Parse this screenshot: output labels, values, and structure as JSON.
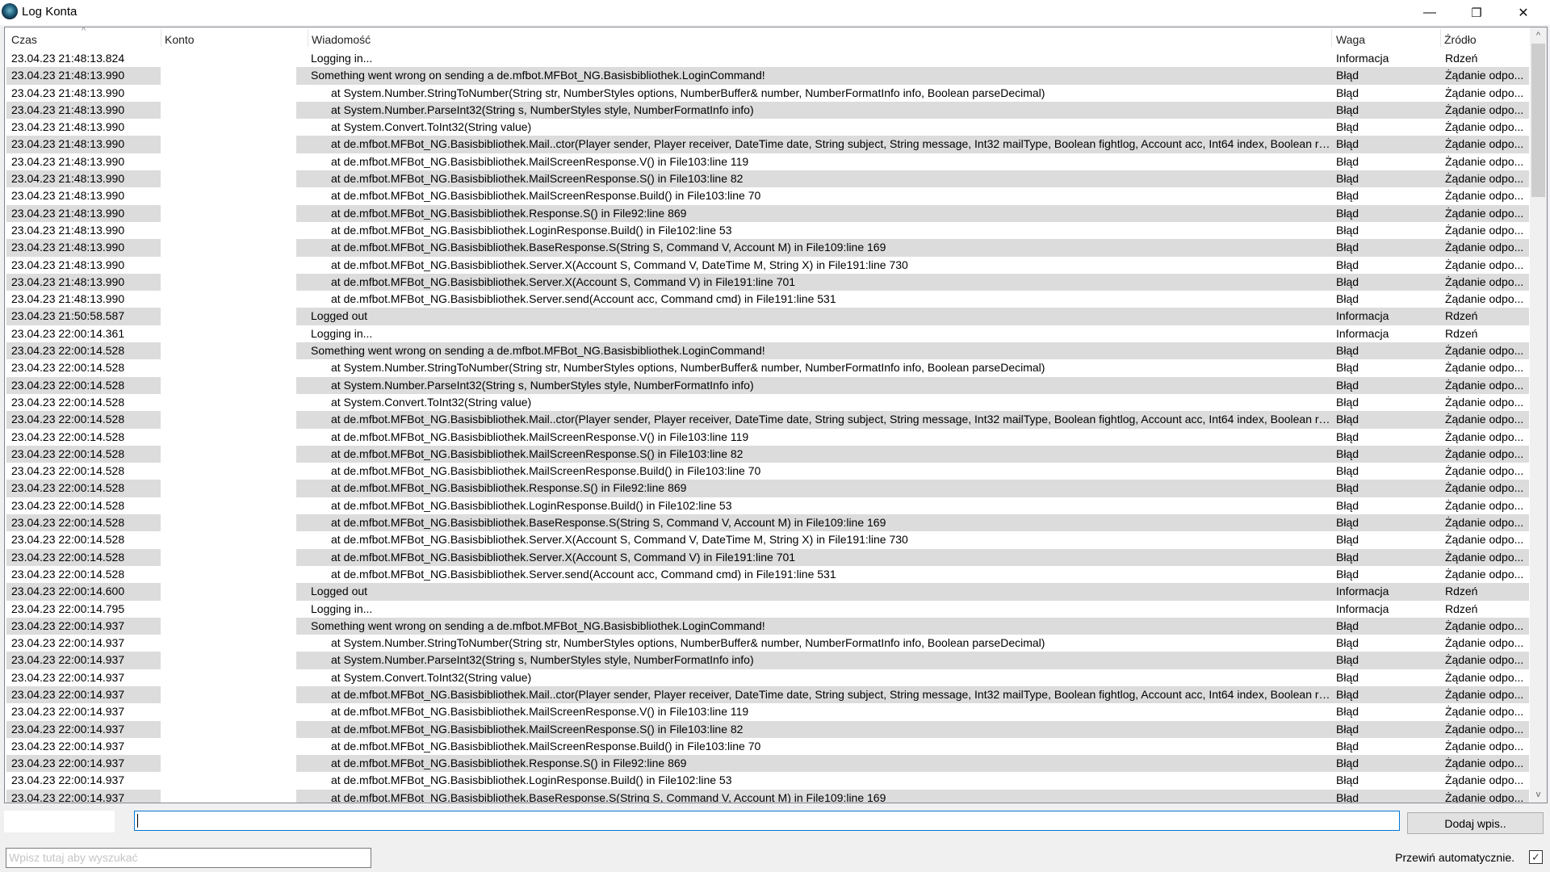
{
  "window": {
    "title": "Log Konta",
    "minimize": "—",
    "restore": "❐",
    "close": "✕"
  },
  "columns": {
    "time": "Czas",
    "account": "Konto",
    "message": "Wiadomość",
    "weight": "Waga",
    "source": "Źródło"
  },
  "rows": [
    [
      "23.04.23 21:48:13.824",
      "",
      "Logging in...",
      "Informacja",
      "Rdzeń"
    ],
    [
      "23.04.23 21:48:13.990",
      "",
      "Something went wrong on sending a de.mfbot.MFBot_NG.Basisbibliothek.LoginCommand!",
      "Błąd",
      "Żądanie odpo..."
    ],
    [
      "23.04.23 21:48:13.990",
      "",
      "at System.Number.StringToNumber(String str, NumberStyles options, NumberBuffer& number, NumberFormatInfo info, Boolean parseDecimal)",
      "Błąd",
      "Żądanie odpo..."
    ],
    [
      "23.04.23 21:48:13.990",
      "",
      "at System.Number.ParseInt32(String s, NumberStyles style, NumberFormatInfo info)",
      "Błąd",
      "Żądanie odpo..."
    ],
    [
      "23.04.23 21:48:13.990",
      "",
      "at System.Convert.ToInt32(String value)",
      "Błąd",
      "Żądanie odpo..."
    ],
    [
      "23.04.23 21:48:13.990",
      "",
      "at de.mfbot.MFBot_NG.Basisbibliothek.Mail..ctor(Player sender, Player receiver, DateTime date, String subject, String message, Int32 mailType, Boolean fightlog, Account acc, Int64 index, Boolean read, Boo...",
      "Błąd",
      "Żądanie odpo..."
    ],
    [
      "23.04.23 21:48:13.990",
      "",
      "at de.mfbot.MFBot_NG.Basisbibliothek.MailScreenResponse.V() in File103:line 119",
      "Błąd",
      "Żądanie odpo..."
    ],
    [
      "23.04.23 21:48:13.990",
      "",
      "at de.mfbot.MFBot_NG.Basisbibliothek.MailScreenResponse.S() in File103:line 82",
      "Błąd",
      "Żądanie odpo..."
    ],
    [
      "23.04.23 21:48:13.990",
      "",
      "at de.mfbot.MFBot_NG.Basisbibliothek.MailScreenResponse.Build() in File103:line 70",
      "Błąd",
      "Żądanie odpo..."
    ],
    [
      "23.04.23 21:48:13.990",
      "",
      "at de.mfbot.MFBot_NG.Basisbibliothek.Response.S() in File92:line 869",
      "Błąd",
      "Żądanie odpo..."
    ],
    [
      "23.04.23 21:48:13.990",
      "",
      "at de.mfbot.MFBot_NG.Basisbibliothek.LoginResponse.Build() in File102:line 53",
      "Błąd",
      "Żądanie odpo..."
    ],
    [
      "23.04.23 21:48:13.990",
      "",
      "at de.mfbot.MFBot_NG.Basisbibliothek.BaseResponse.S(String S, Command V, Account M) in File109:line 169",
      "Błąd",
      "Żądanie odpo..."
    ],
    [
      "23.04.23 21:48:13.990",
      "",
      "at de.mfbot.MFBot_NG.Basisbibliothek.Server.X(Account S, Command V, DateTime M, String X) in File191:line 730",
      "Błąd",
      "Żądanie odpo..."
    ],
    [
      "23.04.23 21:48:13.990",
      "",
      "at de.mfbot.MFBot_NG.Basisbibliothek.Server.X(Account S, Command V) in File191:line 701",
      "Błąd",
      "Żądanie odpo..."
    ],
    [
      "23.04.23 21:48:13.990",
      "",
      "at de.mfbot.MFBot_NG.Basisbibliothek.Server.send(Account acc, Command cmd) in File191:line 531",
      "Błąd",
      "Żądanie odpo..."
    ],
    [
      "23.04.23 21:50:58.587",
      "",
      "Logged out",
      "Informacja",
      "Rdzeń"
    ],
    [
      "23.04.23 22:00:14.361",
      "",
      "Logging in...",
      "Informacja",
      "Rdzeń"
    ],
    [
      "23.04.23 22:00:14.528",
      "",
      "Something went wrong on sending a de.mfbot.MFBot_NG.Basisbibliothek.LoginCommand!",
      "Błąd",
      "Żądanie odpo..."
    ],
    [
      "23.04.23 22:00:14.528",
      "",
      "at System.Number.StringToNumber(String str, NumberStyles options, NumberBuffer& number, NumberFormatInfo info, Boolean parseDecimal)",
      "Błąd",
      "Żądanie odpo..."
    ],
    [
      "23.04.23 22:00:14.528",
      "",
      "at System.Number.ParseInt32(String s, NumberStyles style, NumberFormatInfo info)",
      "Błąd",
      "Żądanie odpo..."
    ],
    [
      "23.04.23 22:00:14.528",
      "",
      "at System.Convert.ToInt32(String value)",
      "Błąd",
      "Żądanie odpo..."
    ],
    [
      "23.04.23 22:00:14.528",
      "",
      "at de.mfbot.MFBot_NG.Basisbibliothek.Mail..ctor(Player sender, Player receiver, DateTime date, String subject, String message, Int32 mailType, Boolean fightlog, Account acc, Int64 index, Boolean read, Boo...",
      "Błąd",
      "Żądanie odpo..."
    ],
    [
      "23.04.23 22:00:14.528",
      "",
      "at de.mfbot.MFBot_NG.Basisbibliothek.MailScreenResponse.V() in File103:line 119",
      "Błąd",
      "Żądanie odpo..."
    ],
    [
      "23.04.23 22:00:14.528",
      "",
      "at de.mfbot.MFBot_NG.Basisbibliothek.MailScreenResponse.S() in File103:line 82",
      "Błąd",
      "Żądanie odpo..."
    ],
    [
      "23.04.23 22:00:14.528",
      "",
      "at de.mfbot.MFBot_NG.Basisbibliothek.MailScreenResponse.Build() in File103:line 70",
      "Błąd",
      "Żądanie odpo..."
    ],
    [
      "23.04.23 22:00:14.528",
      "",
      "at de.mfbot.MFBot_NG.Basisbibliothek.Response.S() in File92:line 869",
      "Błąd",
      "Żądanie odpo..."
    ],
    [
      "23.04.23 22:00:14.528",
      "",
      "at de.mfbot.MFBot_NG.Basisbibliothek.LoginResponse.Build() in File102:line 53",
      "Błąd",
      "Żądanie odpo..."
    ],
    [
      "23.04.23 22:00:14.528",
      "",
      "at de.mfbot.MFBot_NG.Basisbibliothek.BaseResponse.S(String S, Command V, Account M) in File109:line 169",
      "Błąd",
      "Żądanie odpo..."
    ],
    [
      "23.04.23 22:00:14.528",
      "",
      "at de.mfbot.MFBot_NG.Basisbibliothek.Server.X(Account S, Command V, DateTime M, String X) in File191:line 730",
      "Błąd",
      "Żądanie odpo..."
    ],
    [
      "23.04.23 22:00:14.528",
      "",
      "at de.mfbot.MFBot_NG.Basisbibliothek.Server.X(Account S, Command V) in File191:line 701",
      "Błąd",
      "Żądanie odpo..."
    ],
    [
      "23.04.23 22:00:14.528",
      "",
      "at de.mfbot.MFBot_NG.Basisbibliothek.Server.send(Account acc, Command cmd) in File191:line 531",
      "Błąd",
      "Żądanie odpo..."
    ],
    [
      "23.04.23 22:00:14.600",
      "",
      "Logged out",
      "Informacja",
      "Rdzeń"
    ],
    [
      "23.04.23 22:00:14.795",
      "",
      "Logging in...",
      "Informacja",
      "Rdzeń"
    ],
    [
      "23.04.23 22:00:14.937",
      "",
      "Something went wrong on sending a de.mfbot.MFBot_NG.Basisbibliothek.LoginCommand!",
      "Błąd",
      "Żądanie odpo..."
    ],
    [
      "23.04.23 22:00:14.937",
      "",
      "at System.Number.StringToNumber(String str, NumberStyles options, NumberBuffer& number, NumberFormatInfo info, Boolean parseDecimal)",
      "Błąd",
      "Żądanie odpo..."
    ],
    [
      "23.04.23 22:00:14.937",
      "",
      "at System.Number.ParseInt32(String s, NumberStyles style, NumberFormatInfo info)",
      "Błąd",
      "Żądanie odpo..."
    ],
    [
      "23.04.23 22:00:14.937",
      "",
      "at System.Convert.ToInt32(String value)",
      "Błąd",
      "Żądanie odpo..."
    ],
    [
      "23.04.23 22:00:14.937",
      "",
      "at de.mfbot.MFBot_NG.Basisbibliothek.Mail..ctor(Player sender, Player receiver, DateTime date, String subject, String message, Int32 mailType, Boolean fightlog, Account acc, Int64 index, Boolean read, Boo...",
      "Błąd",
      "Żądanie odpo..."
    ],
    [
      "23.04.23 22:00:14.937",
      "",
      "at de.mfbot.MFBot_NG.Basisbibliothek.MailScreenResponse.V() in File103:line 119",
      "Błąd",
      "Żądanie odpo..."
    ],
    [
      "23.04.23 22:00:14.937",
      "",
      "at de.mfbot.MFBot_NG.Basisbibliothek.MailScreenResponse.S() in File103:line 82",
      "Błąd",
      "Żądanie odpo..."
    ],
    [
      "23.04.23 22:00:14.937",
      "",
      "at de.mfbot.MFBot_NG.Basisbibliothek.MailScreenResponse.Build() in File103:line 70",
      "Błąd",
      "Żądanie odpo..."
    ],
    [
      "23.04.23 22:00:14.937",
      "",
      "at de.mfbot.MFBot_NG.Basisbibliothek.Response.S() in File92:line 869",
      "Błąd",
      "Żądanie odpo..."
    ],
    [
      "23.04.23 22:00:14.937",
      "",
      "at de.mfbot.MFBot_NG.Basisbibliothek.LoginResponse.Build() in File102:line 53",
      "Błąd",
      "Żądanie odpo..."
    ],
    [
      "23.04.23 22:00:14.937",
      "",
      "at de.mfbot.MFBot_NG.Basisbibliothek.BaseResponse.S(String S, Command V, Account M) in File109:line 169",
      "Błąd",
      "Żądanie odpo..."
    ]
  ],
  "entry": {
    "value": "",
    "add_button": "Dodaj wpis.."
  },
  "search": {
    "placeholder": "Wpisz tutaj aby wyszukać"
  },
  "autoscroll": {
    "label": "Przewiń automatycznie.",
    "checked": true,
    "mark": "✓"
  },
  "icons": {
    "sort": "^",
    "scroll_up": "^",
    "scroll_down": "v"
  }
}
